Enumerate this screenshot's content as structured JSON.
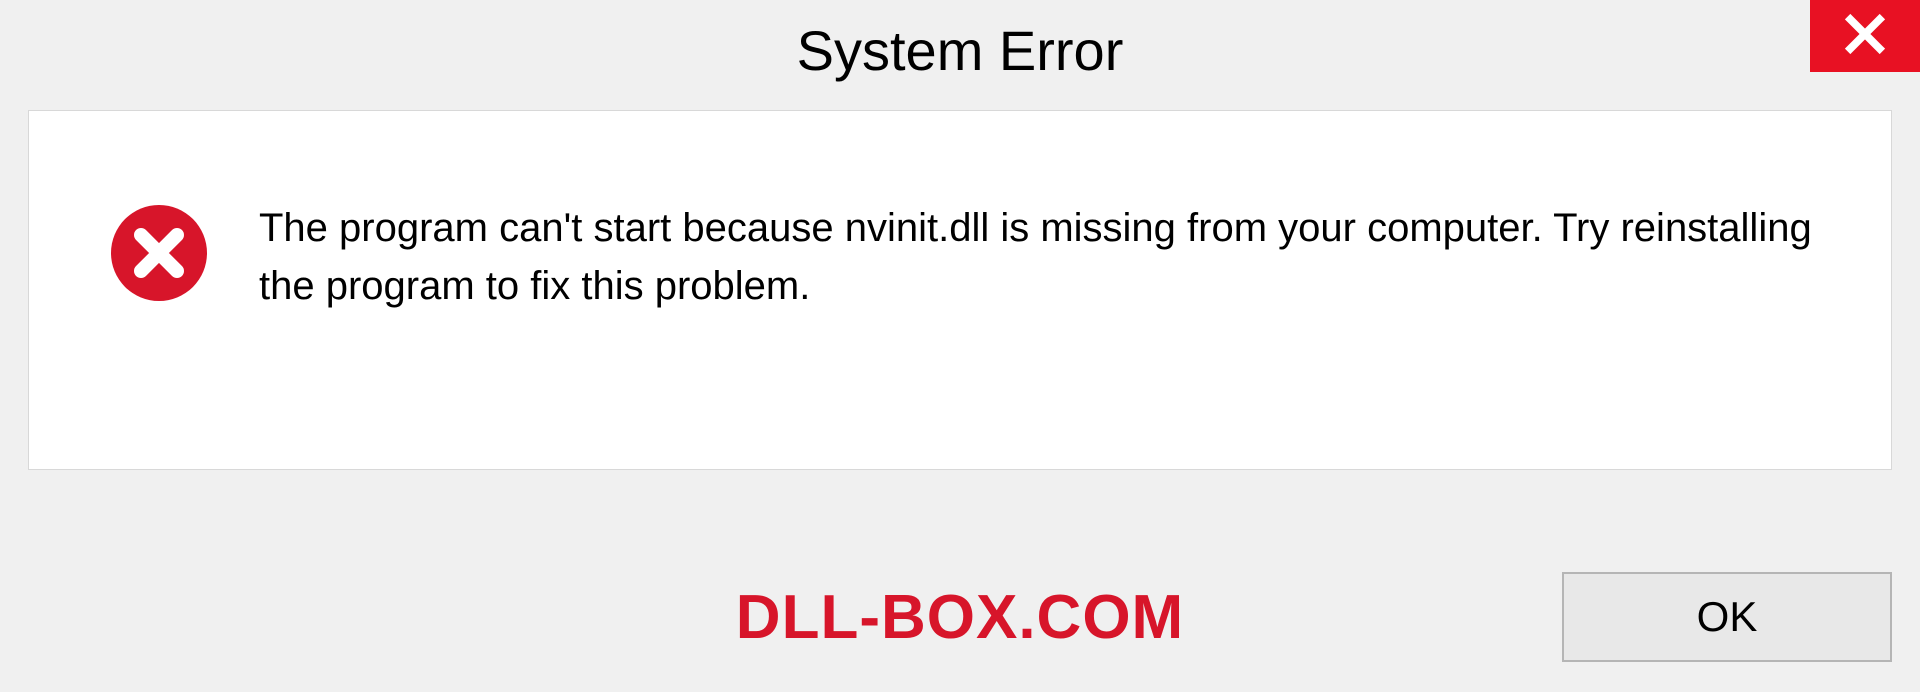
{
  "titlebar": {
    "title": "System Error"
  },
  "dialog": {
    "message": "The program can't start because nvinit.dll is missing from your computer. Try reinstalling the program to fix this problem."
  },
  "footer": {
    "watermark": "DLL-BOX.COM",
    "ok_label": "OK"
  },
  "colors": {
    "close_bg": "#e81123",
    "error_icon": "#d7152a",
    "watermark": "#d7152a"
  }
}
